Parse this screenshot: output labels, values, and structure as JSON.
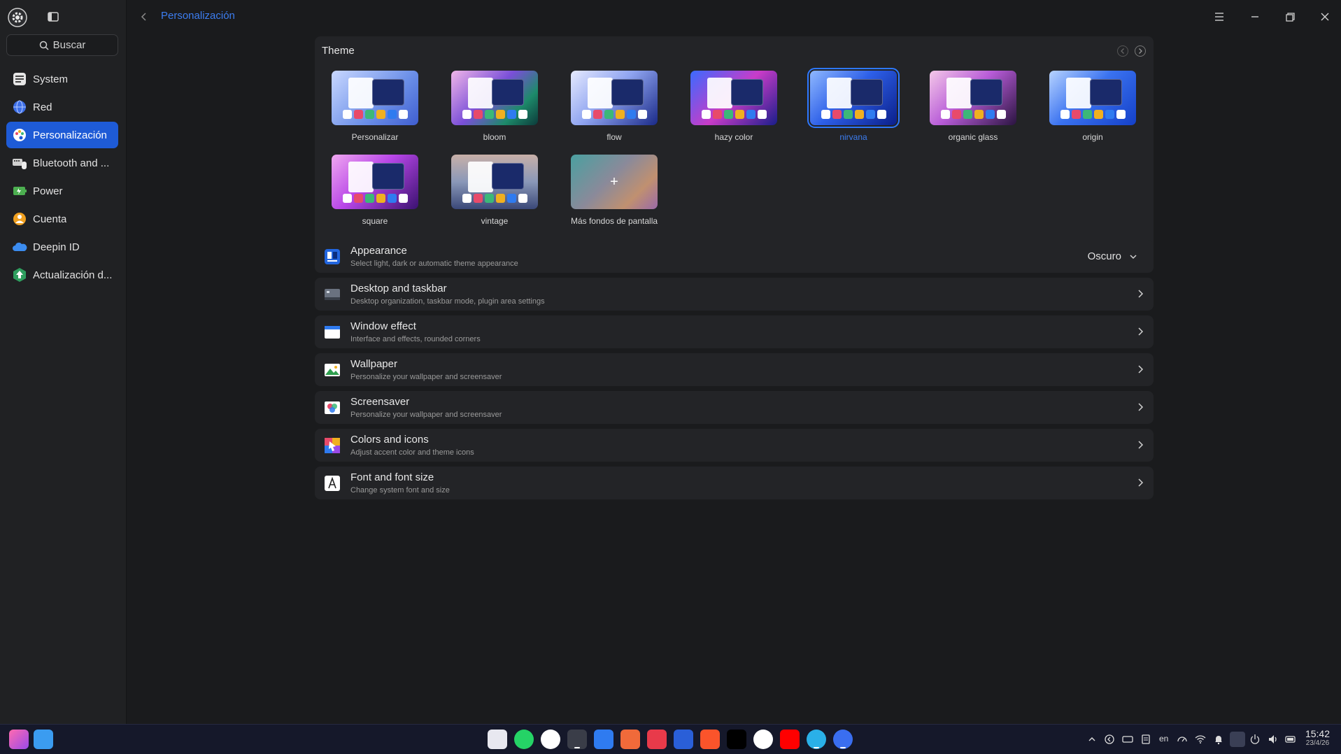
{
  "search": {
    "placeholder": "Buscar"
  },
  "sidebar": {
    "items": [
      {
        "label": "System",
        "icon": "system-icon",
        "color": "#d9d9d9"
      },
      {
        "label": "Red",
        "icon": "globe-icon",
        "color": "#4a7cf0"
      },
      {
        "label": "Personalización",
        "icon": "palette-icon",
        "color": "#ffffff",
        "active": true
      },
      {
        "label": "Bluetooth and ...",
        "icon": "devices-icon",
        "color": "#cfcfcf"
      },
      {
        "label": "Power",
        "icon": "battery-icon",
        "color": "#4caf50"
      },
      {
        "label": "Cuenta",
        "icon": "account-icon",
        "color": "#f0a020"
      },
      {
        "label": "Deepin ID",
        "icon": "cloud-icon",
        "color": "#3b8cf0"
      },
      {
        "label": "Actualización d...",
        "icon": "update-icon",
        "color": "#38b36a"
      }
    ]
  },
  "header": {
    "breadcrumb": "Personalización"
  },
  "theme": {
    "title": "Theme",
    "selected": "nirvana",
    "cards": [
      {
        "label": "Personalizar",
        "bg": "linear-gradient(135deg,#c9d8ff,#6b8fe8 60%,#3f5ed0)"
      },
      {
        "label": "bloom",
        "bg": "linear-gradient(135deg,#f0b6e8,#7a4fd8 45%,#1d8a6a 75%,#0c3a3a)"
      },
      {
        "label": "flow",
        "bg": "linear-gradient(135deg,#e6eaff,#8fa4f0 45%,#1a2a88)"
      },
      {
        "label": "hazy color",
        "bg": "linear-gradient(135deg,#3a6bff,#c83cc8 50%,#1a1e8a)"
      },
      {
        "label": "nirvana",
        "bg": "linear-gradient(135deg,#8fb8ff,#2d5fe8 45%,#0b1f8a)"
      },
      {
        "label": "organic glass",
        "bg": "linear-gradient(135deg,#f4c8e8,#b85cd8 45%,#2a1440)"
      },
      {
        "label": "origin",
        "bg": "linear-gradient(135deg,#b8d4ff,#3a72f0 45%,#1440c8)"
      },
      {
        "label": "square",
        "bg": "linear-gradient(135deg,#f0a8f0,#b846e8 45%,#3a1270)"
      },
      {
        "label": "vintage",
        "bg": "linear-gradient(180deg,#c8b0a8,#8a98b8 50%,#3a4878)"
      },
      {
        "label": "Más fondos de pantalla",
        "bg": "linear-gradient(135deg,#4aa0a0,#8a8a9a 45%,#c09070 75%,#9a6aa8)"
      }
    ]
  },
  "rows": [
    {
      "title": "Appearance",
      "subtitle": "Select light, dark or automatic theme appearance",
      "value": "Oscuro",
      "icon": "appearance-icon"
    },
    {
      "title": "Desktop and taskbar",
      "subtitle": "Desktop organization, taskbar mode, plugin area settings",
      "icon": "desktop-icon"
    },
    {
      "title": "Window effect",
      "subtitle": "Interface and effects, rounded corners",
      "icon": "window-icon"
    },
    {
      "title": "Wallpaper",
      "subtitle": "Personalize your wallpaper and screensaver",
      "icon": "wallpaper-icon"
    },
    {
      "title": "Screensaver",
      "subtitle": "Personalize your wallpaper and screensaver",
      "icon": "screensaver-icon"
    },
    {
      "title": "Colors and icons",
      "subtitle": "Adjust accent color and theme icons",
      "icon": "colors-icon"
    },
    {
      "title": "Font and font size",
      "subtitle": "Change system font and size",
      "icon": "font-icon"
    }
  ],
  "taskbar": {
    "lang": "en",
    "time": "15:42",
    "date": "23/4/26"
  },
  "colors": {
    "accent": "#1e5bd6",
    "link": "#3c7df0",
    "panel": "#232427",
    "background": "#1a1b1d"
  }
}
